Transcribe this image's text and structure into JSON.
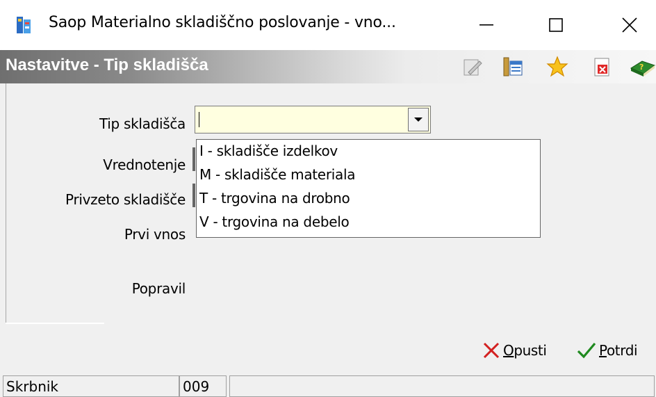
{
  "window": {
    "title": "Saop Materialno skladiščno poslovanje - vno...",
    "icons": {
      "app": "saop-app-icon",
      "minimize": "minimize-icon",
      "maximize": "maximize-icon",
      "close": "close-icon"
    }
  },
  "header": {
    "title": "Nastavitve - Tip skladišča",
    "toolbar": [
      {
        "name": "edit-icon"
      },
      {
        "name": "columns-icon"
      },
      {
        "name": "favorite-star-icon"
      },
      {
        "name": "delete-record-icon"
      },
      {
        "name": "help-book-icon"
      }
    ]
  },
  "form": {
    "labels": {
      "tip_skladisca": "Tip skladišča",
      "vrednotenje": "Vrednotenje",
      "privzeto_skladisce": "Privzeto skladišče",
      "prvi_vnos": "Prvi vnos",
      "popravil": "Popravil"
    },
    "tip_skladisca_value": "",
    "dropdown_options": [
      "I - skladišče izdelkov",
      "M - skladišče materiala",
      "T - trgovina na drobno",
      "V - trgovina na debelo"
    ]
  },
  "actions": {
    "cancel": {
      "accel": "O",
      "rest": "pusti"
    },
    "confirm": {
      "accel": "P",
      "rest": "otrdi"
    }
  },
  "status": {
    "user": "Skrbnik",
    "code": "009",
    "message": ""
  },
  "colors": {
    "combo_bg": "#ffffe0",
    "cancel_icon": "#d32020",
    "confirm_icon": "#1f8a1f"
  }
}
